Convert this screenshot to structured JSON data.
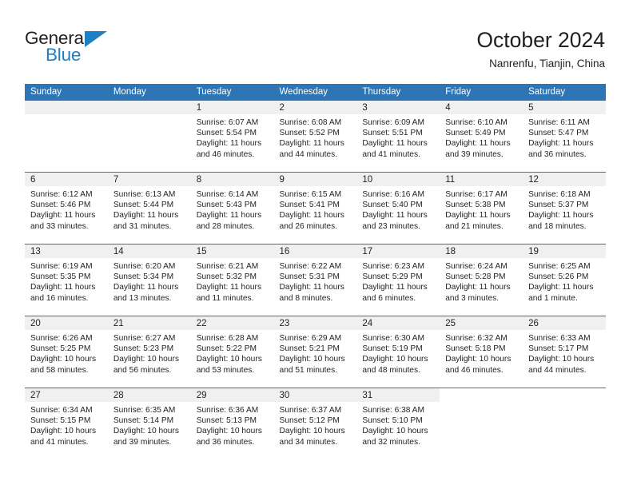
{
  "brand": {
    "name_top": "General",
    "name_bottom": "Blue",
    "triangle_icon": "triangle-icon",
    "color_black": "#231f20",
    "color_blue": "#1f7fc4"
  },
  "header": {
    "title": "October 2024",
    "subtitle": "Nanrenfu, Tianjin, China"
  },
  "theme": {
    "header_blue": "#2e75b6",
    "day_strip_gray": "#f0f0f0",
    "text": "#231f20"
  },
  "weekdays": [
    "Sunday",
    "Monday",
    "Tuesday",
    "Wednesday",
    "Thursday",
    "Friday",
    "Saturday"
  ],
  "labels": {
    "sunrise_prefix": "Sunrise:",
    "sunset_prefix": "Sunset:",
    "daylight_prefix": "Daylight:"
  },
  "weeks": [
    [
      {
        "empty": true
      },
      {
        "empty": true
      },
      {
        "day": "1",
        "sunrise": "Sunrise: 6:07 AM",
        "sunset": "Sunset: 5:54 PM",
        "daylight": "Daylight: 11 hours and 46 minutes."
      },
      {
        "day": "2",
        "sunrise": "Sunrise: 6:08 AM",
        "sunset": "Sunset: 5:52 PM",
        "daylight": "Daylight: 11 hours and 44 minutes."
      },
      {
        "day": "3",
        "sunrise": "Sunrise: 6:09 AM",
        "sunset": "Sunset: 5:51 PM",
        "daylight": "Daylight: 11 hours and 41 minutes."
      },
      {
        "day": "4",
        "sunrise": "Sunrise: 6:10 AM",
        "sunset": "Sunset: 5:49 PM",
        "daylight": "Daylight: 11 hours and 39 minutes."
      },
      {
        "day": "5",
        "sunrise": "Sunrise: 6:11 AM",
        "sunset": "Sunset: 5:47 PM",
        "daylight": "Daylight: 11 hours and 36 minutes."
      }
    ],
    [
      {
        "day": "6",
        "sunrise": "Sunrise: 6:12 AM",
        "sunset": "Sunset: 5:46 PM",
        "daylight": "Daylight: 11 hours and 33 minutes."
      },
      {
        "day": "7",
        "sunrise": "Sunrise: 6:13 AM",
        "sunset": "Sunset: 5:44 PM",
        "daylight": "Daylight: 11 hours and 31 minutes."
      },
      {
        "day": "8",
        "sunrise": "Sunrise: 6:14 AM",
        "sunset": "Sunset: 5:43 PM",
        "daylight": "Daylight: 11 hours and 28 minutes."
      },
      {
        "day": "9",
        "sunrise": "Sunrise: 6:15 AM",
        "sunset": "Sunset: 5:41 PM",
        "daylight": "Daylight: 11 hours and 26 minutes."
      },
      {
        "day": "10",
        "sunrise": "Sunrise: 6:16 AM",
        "sunset": "Sunset: 5:40 PM",
        "daylight": "Daylight: 11 hours and 23 minutes."
      },
      {
        "day": "11",
        "sunrise": "Sunrise: 6:17 AM",
        "sunset": "Sunset: 5:38 PM",
        "daylight": "Daylight: 11 hours and 21 minutes."
      },
      {
        "day": "12",
        "sunrise": "Sunrise: 6:18 AM",
        "sunset": "Sunset: 5:37 PM",
        "daylight": "Daylight: 11 hours and 18 minutes."
      }
    ],
    [
      {
        "day": "13",
        "sunrise": "Sunrise: 6:19 AM",
        "sunset": "Sunset: 5:35 PM",
        "daylight": "Daylight: 11 hours and 16 minutes."
      },
      {
        "day": "14",
        "sunrise": "Sunrise: 6:20 AM",
        "sunset": "Sunset: 5:34 PM",
        "daylight": "Daylight: 11 hours and 13 minutes."
      },
      {
        "day": "15",
        "sunrise": "Sunrise: 6:21 AM",
        "sunset": "Sunset: 5:32 PM",
        "daylight": "Daylight: 11 hours and 11 minutes."
      },
      {
        "day": "16",
        "sunrise": "Sunrise: 6:22 AM",
        "sunset": "Sunset: 5:31 PM",
        "daylight": "Daylight: 11 hours and 8 minutes."
      },
      {
        "day": "17",
        "sunrise": "Sunrise: 6:23 AM",
        "sunset": "Sunset: 5:29 PM",
        "daylight": "Daylight: 11 hours and 6 minutes."
      },
      {
        "day": "18",
        "sunrise": "Sunrise: 6:24 AM",
        "sunset": "Sunset: 5:28 PM",
        "daylight": "Daylight: 11 hours and 3 minutes."
      },
      {
        "day": "19",
        "sunrise": "Sunrise: 6:25 AM",
        "sunset": "Sunset: 5:26 PM",
        "daylight": "Daylight: 11 hours and 1 minute."
      }
    ],
    [
      {
        "day": "20",
        "sunrise": "Sunrise: 6:26 AM",
        "sunset": "Sunset: 5:25 PM",
        "daylight": "Daylight: 10 hours and 58 minutes."
      },
      {
        "day": "21",
        "sunrise": "Sunrise: 6:27 AM",
        "sunset": "Sunset: 5:23 PM",
        "daylight": "Daylight: 10 hours and 56 minutes."
      },
      {
        "day": "22",
        "sunrise": "Sunrise: 6:28 AM",
        "sunset": "Sunset: 5:22 PM",
        "daylight": "Daylight: 10 hours and 53 minutes."
      },
      {
        "day": "23",
        "sunrise": "Sunrise: 6:29 AM",
        "sunset": "Sunset: 5:21 PM",
        "daylight": "Daylight: 10 hours and 51 minutes."
      },
      {
        "day": "24",
        "sunrise": "Sunrise: 6:30 AM",
        "sunset": "Sunset: 5:19 PM",
        "daylight": "Daylight: 10 hours and 48 minutes."
      },
      {
        "day": "25",
        "sunrise": "Sunrise: 6:32 AM",
        "sunset": "Sunset: 5:18 PM",
        "daylight": "Daylight: 10 hours and 46 minutes."
      },
      {
        "day": "26",
        "sunrise": "Sunrise: 6:33 AM",
        "sunset": "Sunset: 5:17 PM",
        "daylight": "Daylight: 10 hours and 44 minutes."
      }
    ],
    [
      {
        "day": "27",
        "sunrise": "Sunrise: 6:34 AM",
        "sunset": "Sunset: 5:15 PM",
        "daylight": "Daylight: 10 hours and 41 minutes."
      },
      {
        "day": "28",
        "sunrise": "Sunrise: 6:35 AM",
        "sunset": "Sunset: 5:14 PM",
        "daylight": "Daylight: 10 hours and 39 minutes."
      },
      {
        "day": "29",
        "sunrise": "Sunrise: 6:36 AM",
        "sunset": "Sunset: 5:13 PM",
        "daylight": "Daylight: 10 hours and 36 minutes."
      },
      {
        "day": "30",
        "sunrise": "Sunrise: 6:37 AM",
        "sunset": "Sunset: 5:12 PM",
        "daylight": "Daylight: 10 hours and 34 minutes."
      },
      {
        "day": "31",
        "sunrise": "Sunrise: 6:38 AM",
        "sunset": "Sunset: 5:10 PM",
        "daylight": "Daylight: 10 hours and 32 minutes."
      },
      {
        "blank": true
      },
      {
        "blank": true
      }
    ]
  ]
}
